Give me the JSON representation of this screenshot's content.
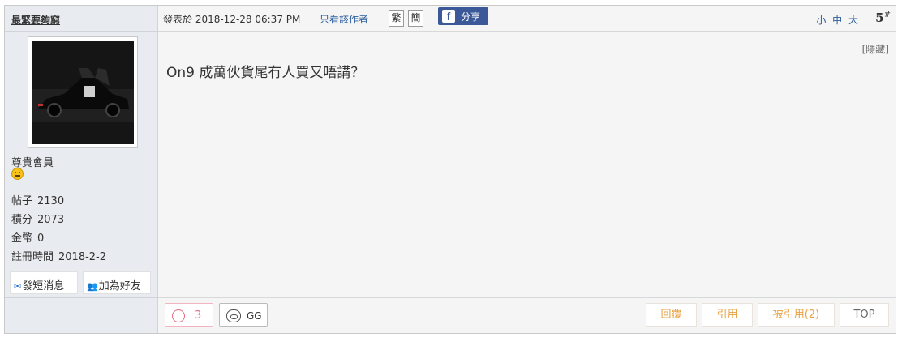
{
  "user": {
    "name": "最緊要夠窮",
    "group": "尊貴會員",
    "stats": [
      {
        "label": "帖子",
        "value": "2130"
      },
      {
        "label": "積分",
        "value": "2073"
      },
      {
        "label": "金幣",
        "value": "0"
      },
      {
        "label": "註冊時間",
        "value": "2018-2-2"
      }
    ],
    "pm_label": "發短消息",
    "add_friend_label": "加為好友"
  },
  "header": {
    "posted_at": "發表於 2018-12-28 06:37 PM",
    "only_author": "只看該作者",
    "trad_label": "繁",
    "simp_label": "簡",
    "share_label": "分享",
    "font_sizes": "小 中 大",
    "floor_number": "5",
    "floor_suffix": "#"
  },
  "post": {
    "hidden_label": "[隱藏]",
    "content": "On9  成萬伙貨尾冇人買又唔講？"
  },
  "footer": {
    "like_count": "3",
    "gg_label": "GG",
    "reply_label": "回覆",
    "quote_label": "引用",
    "quoted_label": "被引用(2)",
    "top_label": "TOP"
  },
  "colors": {
    "link": "#2a5d9b",
    "action": "#e8a040",
    "facebook": "#3b5998",
    "like": "#e66b83"
  }
}
